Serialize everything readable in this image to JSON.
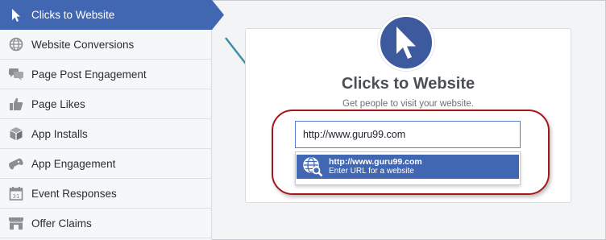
{
  "sidebar": {
    "items": [
      {
        "label": "Clicks to Website",
        "icon": "cursor-icon",
        "active": true
      },
      {
        "label": "Website Conversions",
        "icon": "globe-icon"
      },
      {
        "label": "Page Post Engagement",
        "icon": "comments-icon"
      },
      {
        "label": "Page Likes",
        "icon": "thumbs-up-icon"
      },
      {
        "label": "App Installs",
        "icon": "box-icon"
      },
      {
        "label": "App Engagement",
        "icon": "gamepad-icon"
      },
      {
        "label": "Event Responses",
        "icon": "calendar-icon"
      },
      {
        "label": "Offer Claims",
        "icon": "store-icon"
      }
    ]
  },
  "main": {
    "icon": "cursor-icon",
    "title": "Clicks to Website",
    "subtitle": "Get people to visit your website.",
    "url_input": {
      "value": "http://www.guru99.com"
    },
    "suggestion": {
      "url": "http://www.guru99.com",
      "hint": "Enter URL for a website",
      "icon": "globe-search-icon"
    }
  },
  "colors": {
    "accent": "#4267b2",
    "highlight_ring": "#a4161a",
    "arrow": "#3e8fa5"
  }
}
